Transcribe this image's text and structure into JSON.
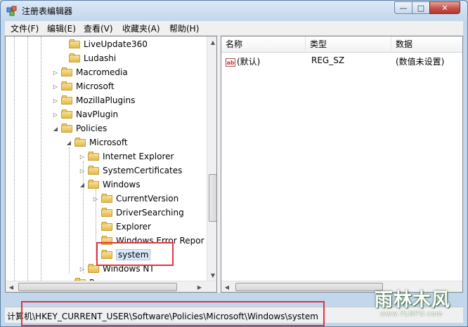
{
  "window": {
    "title": "注册表编辑器",
    "controls": {
      "minimize": "—",
      "maximize": "□",
      "close": "✕"
    }
  },
  "menu": [
    "文件(F)",
    "编辑(E)",
    "查看(V)",
    "收藏夹(A)",
    "帮助(H)"
  ],
  "tree": [
    {
      "label": "LiveUpdate360",
      "expander": ""
    },
    {
      "label": "Ludashi",
      "expander": ""
    },
    {
      "label": "Macromedia",
      "expander": "▷"
    },
    {
      "label": "Microsoft",
      "expander": "▷"
    },
    {
      "label": "MozillaPlugins",
      "expander": "▷"
    },
    {
      "label": "NavPlugin",
      "expander": "▷"
    },
    {
      "label": "Policies",
      "expander": "◢"
    },
    {
      "label": "Microsoft",
      "expander": "◢"
    },
    {
      "label": "Internet Explorer",
      "expander": "▷"
    },
    {
      "label": "SystemCertificates",
      "expander": "▷"
    },
    {
      "label": "Windows",
      "expander": "◢"
    },
    {
      "label": "CurrentVersion",
      "expander": "▷"
    },
    {
      "label": "DriverSearching",
      "expander": ""
    },
    {
      "label": "Explorer",
      "expander": ""
    },
    {
      "label": "Windows Error Repor",
      "expander": ""
    },
    {
      "label": "system",
      "expander": "",
      "selected": true
    },
    {
      "label": "Windows NT",
      "expander": "▷"
    },
    {
      "label": "Power",
      "expander": "▷"
    }
  ],
  "list": {
    "columns": [
      "名称",
      "类型",
      "数据"
    ],
    "rows": [
      {
        "icon": "ab",
        "name": "(默认)",
        "type": "REG_SZ",
        "data": "(数值未设置)"
      }
    ]
  },
  "status": "计算机\\HKEY_CURRENT_USER\\Software\\Policies\\Microsoft\\Windows\\system",
  "watermark": {
    "main": "雨林木风",
    "sub": "www.YLMFU.com"
  },
  "colors": {
    "highlight": "#e2343e",
    "selection": "#d9e8fb"
  }
}
